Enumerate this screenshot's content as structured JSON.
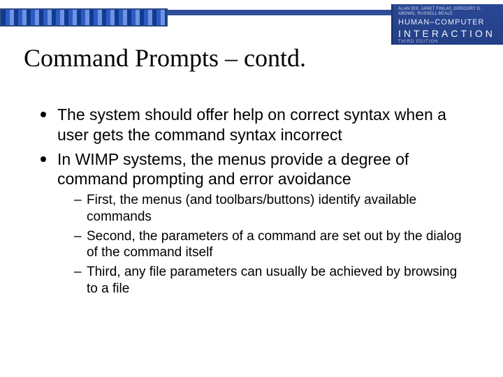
{
  "header": {
    "authors": "ALAN DIX, JANET FINLAY, GREGORY D. ABOWD, RUSSELL BEALE",
    "book_title_top": "HUMAN–COMPUTER",
    "book_title_bot": "INTERACTION",
    "edition": "THIRD EDITION"
  },
  "title": "Command Prompts – contd.",
  "bullets": [
    "The system should offer help on correct syntax when a user gets the command syntax incorrect",
    "In WIMP systems, the menus provide a degree of command prompting and error avoidance"
  ],
  "subbullets": [
    "First, the menus (and toolbars/buttons) identify available commands",
    "Second, the parameters of a command are set out by the dialog of the command itself",
    "Third, any file parameters can usually be achieved by browsing to a file"
  ]
}
